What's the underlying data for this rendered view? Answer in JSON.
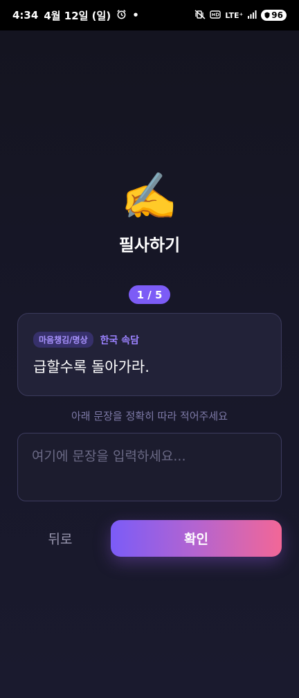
{
  "status_bar": {
    "time": "4:34",
    "date": "4월 12일 (일)",
    "dot": "•",
    "network": "LTE⁺",
    "battery": "96"
  },
  "hero": {
    "emoji": "✍️",
    "title": "필사하기"
  },
  "progress": {
    "label": "1 / 5",
    "current": 1,
    "total": 5
  },
  "card": {
    "category": "마음챙김/명상",
    "source": "한국 속담",
    "quote": "급할수록 돌아가라."
  },
  "instruction": "아래 문장을 정확히 따라 적어주세요",
  "input": {
    "value": "",
    "placeholder": "여기에 문장을 입력하세요..."
  },
  "buttons": {
    "back": "뒤로",
    "confirm": "확인"
  },
  "colors": {
    "accent": "#7c5cf6",
    "gradient_start": "#7b5cf7",
    "gradient_end": "#f26797",
    "background": "#171728"
  }
}
